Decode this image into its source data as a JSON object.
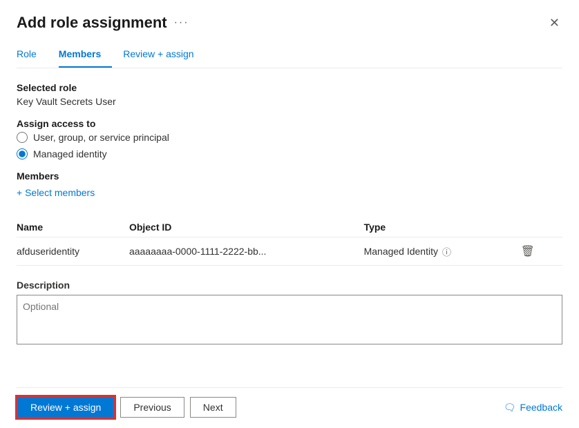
{
  "dialog": {
    "title": "Add role assignment",
    "more_icon": "···",
    "close_icon": "✕"
  },
  "tabs": [
    {
      "id": "role",
      "label": "Role",
      "active": false
    },
    {
      "id": "members",
      "label": "Members",
      "active": true
    },
    {
      "id": "review",
      "label": "Review + assign",
      "active": false
    }
  ],
  "form": {
    "selected_role_label": "Selected role",
    "selected_role_value": "Key Vault Secrets User",
    "assign_access_label": "Assign access to",
    "radio_options": [
      {
        "id": "user-group",
        "label": "User, group, or service principal",
        "checked": false
      },
      {
        "id": "managed-identity",
        "label": "Managed identity",
        "checked": true
      }
    ],
    "members_label": "Members",
    "add_members_label": "+ Select members",
    "table": {
      "columns": [
        "Name",
        "Object ID",
        "Type"
      ],
      "rows": [
        {
          "name": "afduseridentity",
          "object_id": "aaaaaaaa-0000-1111-2222-bb...",
          "type": "Managed Identity"
        }
      ]
    },
    "description_label": "Description",
    "description_placeholder": "Optional"
  },
  "footer": {
    "review_assign_label": "Review + assign",
    "previous_label": "Previous",
    "next_label": "Next",
    "feedback_label": "Feedback",
    "feedback_icon": "💬"
  }
}
